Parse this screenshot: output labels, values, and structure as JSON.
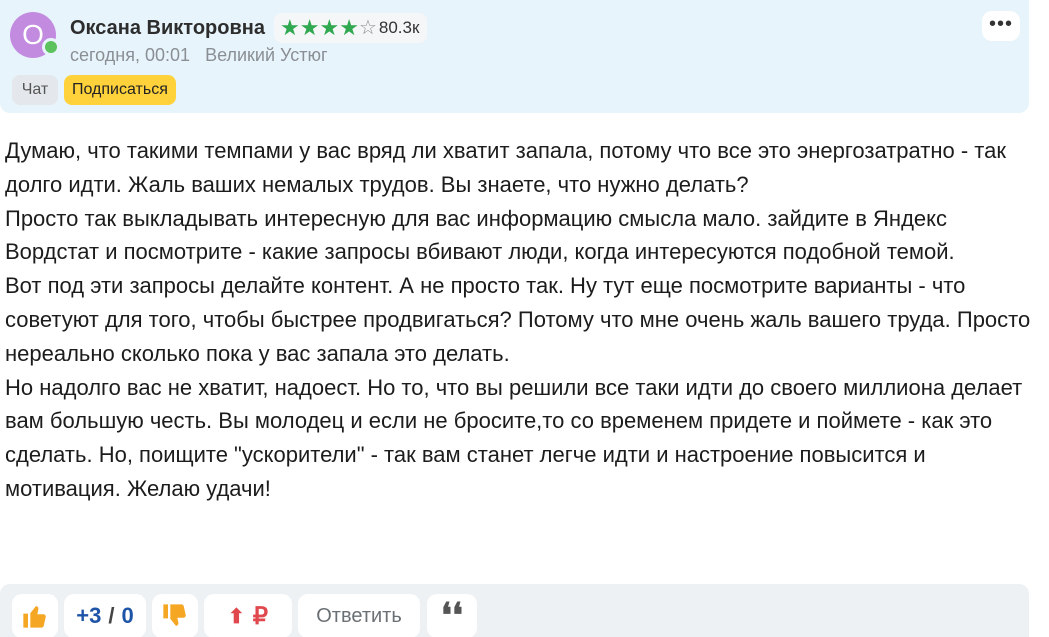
{
  "author": {
    "avatar_letter": "О",
    "name": "Оксана Викторовна",
    "rating_stars_filled": 4,
    "rating_stars_total": 5,
    "rating_count": "80.3к",
    "date": "сегодня, 00:01",
    "location": "Великий Устюг",
    "online": true
  },
  "header_buttons": {
    "chat_label": "Чат",
    "subscribe_label": "Подписаться",
    "more_label": "•••"
  },
  "comment": {
    "paragraphs": [
      "Думаю, что такими темпами у вас вряд ли хватит запала, потому что все это энергозатратно - так долго идти. Жаль ваших немалых трудов. Вы знаете, что нужно делать?",
      "Просто так выкладывать интересную для вас информацию смысла мало. зайдите в Яндекс Вордстат и посмотрите - какие запросы вбивают люди, когда интересуются подобной темой.",
      "Вот под эти запросы делайте контент. А не просто так. Ну тут еще посмотрите варианты - что советуют для того, чтобы быстрее продвигаться? Потому что мне очень жаль вашего труда. Просто нереально сколько пока у вас запала это делать.",
      "Но надолго вас не хватит, надоест. Но то, что вы решили все таки идти до своего миллиона делает вам большую честь. Вы молодец и если не бросите,то со временем придете и поймете - как это сделать. Но, поищите \"ускорители\" - так вам станет легче идти и настроение повысится и мотивация. Желаю удачи!"
    ]
  },
  "actions": {
    "score_plus": "+3",
    "score_separator": "/",
    "score_minus": "0",
    "donate_arrow": "⬆",
    "donate_currency": "₽",
    "reply_label": "Ответить",
    "quote_label": "❛❛"
  },
  "colors": {
    "header_bg": "#e8f4fb",
    "star": "#2fa84f",
    "subscribe": "#ffd23c",
    "like": "#f5a623",
    "dislike": "#f5a623",
    "donate": "#e0484d",
    "score": "#1e54a8"
  }
}
